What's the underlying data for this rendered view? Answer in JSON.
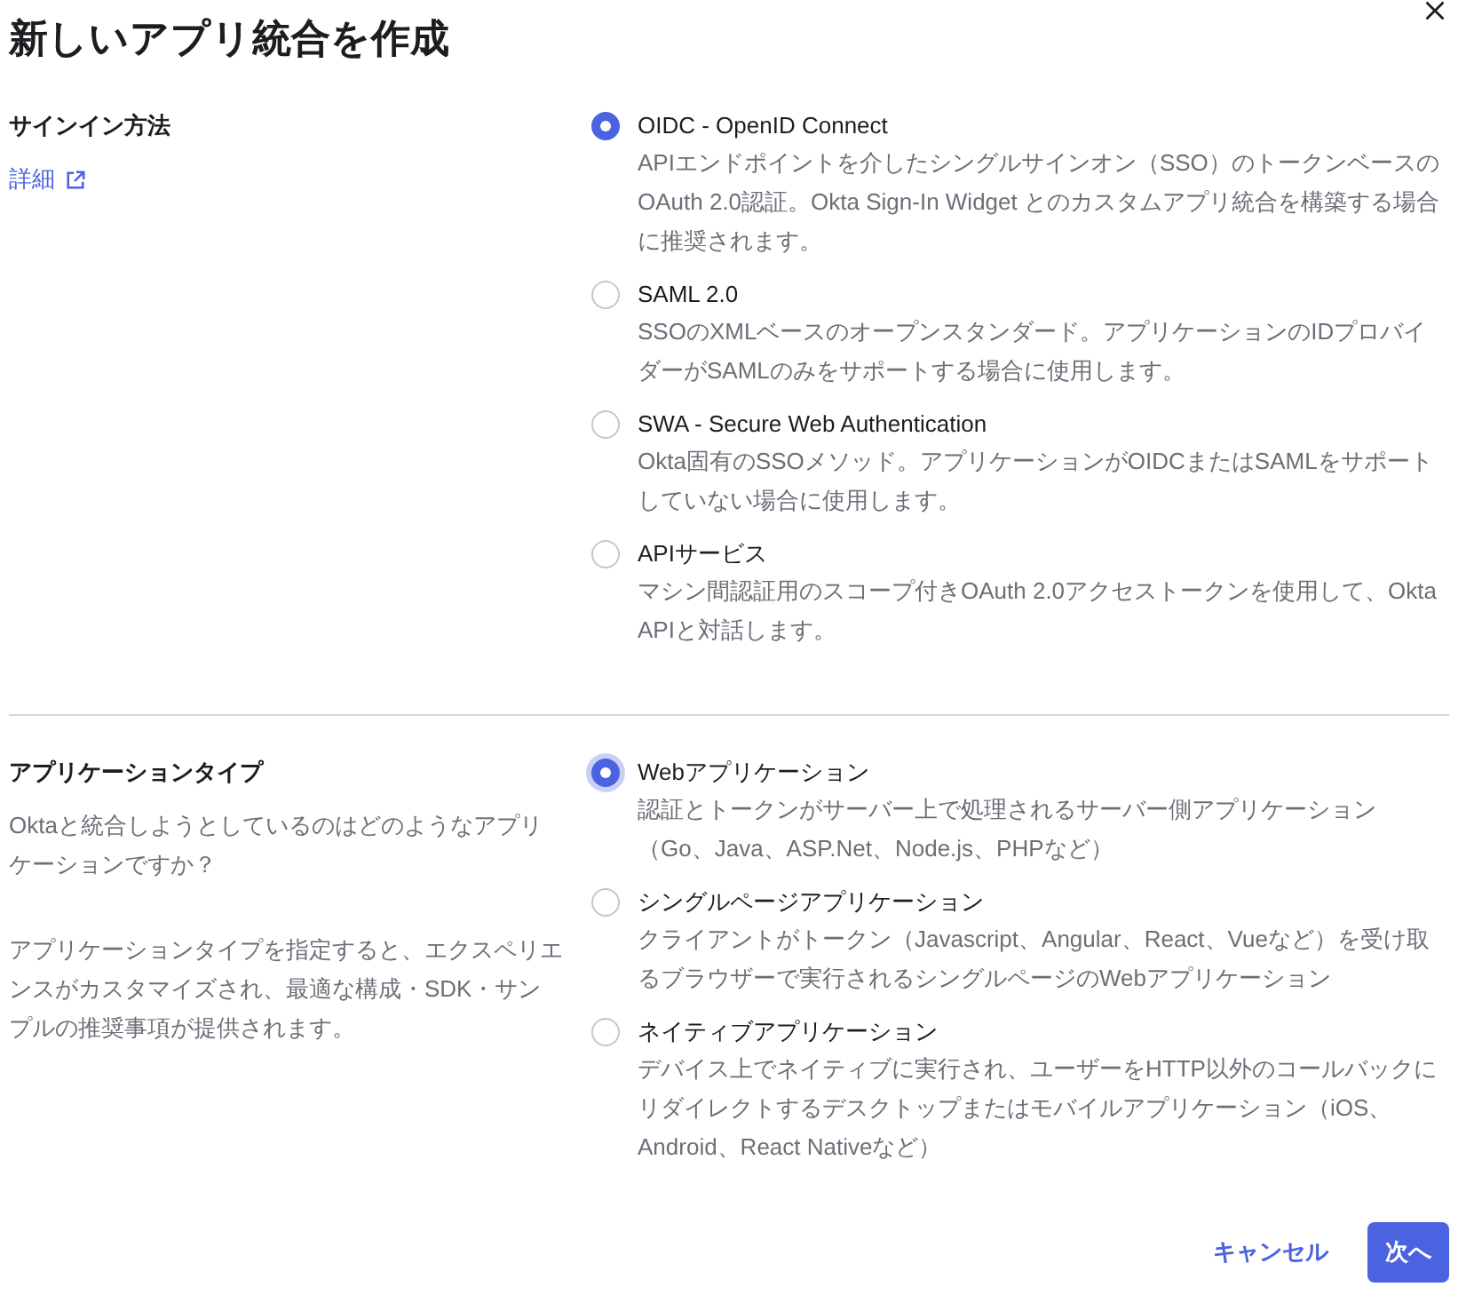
{
  "dialog": {
    "title": "新しいアプリ統合を作成"
  },
  "sections": [
    {
      "label": "サインイン方法",
      "link": {
        "text": "詳細"
      },
      "options": [
        {
          "title": "OIDC - OpenID Connect",
          "description": "APIエンドポイントを介したシングルサインオン（SSO）のトークンベースのOAuth 2.0認証。Okta Sign-In Widget とのカスタムアプリ統合を構築する場合に推奨されます。",
          "selected": true,
          "focused": false
        },
        {
          "title": "SAML 2.0",
          "description": "SSOのXMLベースのオープンスタンダード。アプリケーションのIDプロバイダーがSAMLのみをサポートする場合に使用します。",
          "selected": false,
          "focused": false
        },
        {
          "title": "SWA - Secure Web Authentication",
          "description": "Okta固有のSSOメソッド。アプリケーションがOIDCまたはSAMLをサポートしていない場合に使用します。",
          "selected": false,
          "focused": false
        },
        {
          "title": "APIサービス",
          "description": "マシン間認証用のスコープ付きOAuth 2.0アクセストークンを使用して、Okta APIと対話します。",
          "selected": false,
          "focused": false
        }
      ]
    },
    {
      "label": "アプリケーションタイプ",
      "paragraphs": [
        "Oktaと統合しようとしているのはどのようなアプリケーションですか？",
        "アプリケーションタイプを指定すると、エクスペリエンスがカスタマイズされ、最適な構成・SDK・サンプルの推奨事項が提供されます。"
      ],
      "options": [
        {
          "title": "Webアプリケーション",
          "description": "認証とトークンがサーバー上で処理されるサーバー側アプリケーション（Go、Java、ASP.Net、Node.js、PHPなど）",
          "selected": true,
          "focused": true
        },
        {
          "title": "シングルページアプリケーション",
          "description": "クライアントがトークン（Javascript、Angular、React、Vueなど）を受け取るブラウザーで実行されるシングルページのWebアプリケーション",
          "selected": false,
          "focused": false
        },
        {
          "title": "ネイティブアプリケーション",
          "description": "デバイス上でネイティブに実行され、ユーザーをHTTP以外のコールバックにリダイレクトするデスクトップまたはモバイルアプリケーション（iOS、Android、React Nativeなど）",
          "selected": false,
          "focused": false
        }
      ]
    }
  ],
  "buttons": [
    {
      "label": "キャンセル",
      "kind": "secondary"
    },
    {
      "label": "次へ",
      "kind": "primary"
    }
  ]
}
